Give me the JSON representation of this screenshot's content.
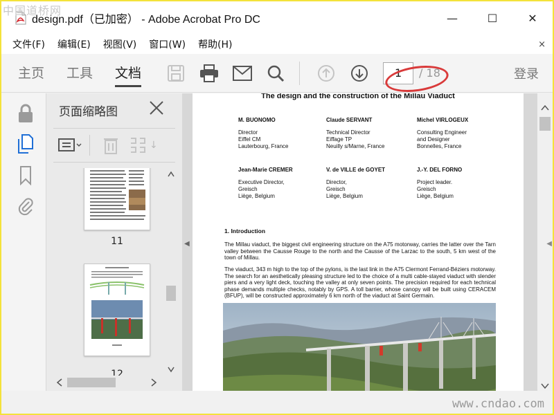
{
  "watermarks": {
    "top_left": "中国道桥网",
    "bottom_right": "www.cndao.com"
  },
  "window": {
    "title": "design.pdf（已加密） - Adobe Acrobat Pro DC",
    "minimize": "—",
    "maximize": "☐",
    "close": "✕"
  },
  "menu": {
    "items": [
      "文件(F)",
      "编辑(E)",
      "视图(V)",
      "窗口(W)",
      "帮助(H)"
    ],
    "close": "×"
  },
  "toolbar": {
    "tabs": [
      "主页",
      "工具",
      "文档"
    ],
    "active_tab": "文档",
    "page_current": "1",
    "page_total": "/ 18",
    "login": "登录"
  },
  "colors": {
    "accent_red": "#d93a3a",
    "frame_yellow": "#f4e23a",
    "active_icon_blue": "#1f6fd6"
  },
  "thumbnails": {
    "panel_title": "页面缩略图",
    "pages": [
      {
        "number": "11"
      },
      {
        "number": "12"
      }
    ]
  },
  "document": {
    "title": "The design and the construction of the Millau Viaduct",
    "authors_row1": [
      {
        "name": "M. BUONOMO",
        "lines": [
          "Director",
          "Eiffel CM",
          "Lauterbourg, France"
        ]
      },
      {
        "name": "Claude SERVANT",
        "lines": [
          "Technical Director",
          "Eiffage TP",
          "Neuilly s/Marne, France"
        ]
      },
      {
        "name": "Michel VIRLOGEUX",
        "lines": [
          "Consulting Engineer",
          "and Designer",
          "Bonnelles, France"
        ]
      }
    ],
    "authors_row2": [
      {
        "name": "Jean-Marie CREMER",
        "lines": [
          "Executive Director,",
          "Greisch",
          "Liège, Belgium"
        ]
      },
      {
        "name": "V. de VILLE de GOYET",
        "lines": [
          "Director,",
          "Greisch",
          "Liège, Belgium"
        ]
      },
      {
        "name": "J.-Y. DEL FORNO",
        "lines": [
          "Project leader.",
          "Greisch",
          "Liège, Belgium"
        ]
      }
    ],
    "section_heading": "1. Introduction",
    "paragraph1": "The Millau viaduct, the biggest civil engineering structure on the A75 motorway, carries the latter over the Tarn valley between the Causse Rouge to the north and the Causse of the Larzac to the south, 5 km west of the town of Millau.",
    "paragraph2": "The viaduct, 343 m high to the top of the pylons, is the last link in the A75 Clermont Ferrand-Béziers motorway. The search for an aesthetically pleasing structure led to the choice of a multi cable-stayed viaduct with slender piers and a very light deck, touching the valley at only seven points. The precision required for each technical phase demands multiple checks, notably by GPS. A toll barrier, whose canopy will be built using CERACEM (BFUP), will be constructed approximately 6 km north of the viaduct at Saint Germain."
  }
}
